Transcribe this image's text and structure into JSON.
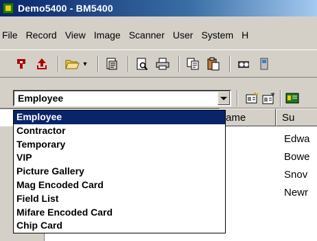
{
  "window": {
    "title": "Demo5400 - BM5400"
  },
  "menu": [
    "File",
    "Record",
    "View",
    "Image",
    "Scanner",
    "User",
    "System",
    "H"
  ],
  "record_type": {
    "selected": "Employee",
    "options": [
      "Employee",
      "Contractor",
      "Temporary",
      "VIP",
      "Picture Gallery",
      "Mag Encoded Card",
      "Field List",
      "Mifare Encoded Card",
      "Chip Card"
    ]
  },
  "table": {
    "headers": [
      "ame",
      "Su"
    ],
    "surname_cells": [
      "Edwa",
      "Bowe",
      "Snov",
      "Newr"
    ]
  },
  "colors": {
    "title_start": "#0a246a",
    "title_end": "#a6caf0",
    "selection": "#0a246a",
    "face": "#d4d0c8"
  }
}
